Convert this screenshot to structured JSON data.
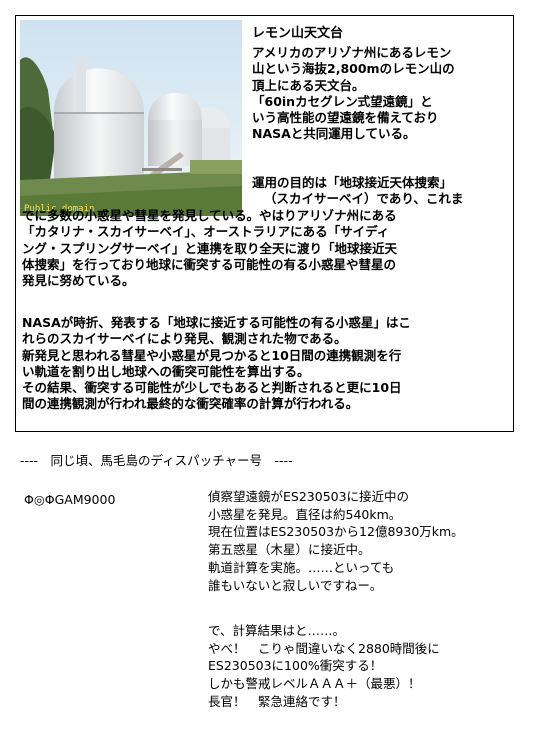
{
  "box": {
    "photo_credit": "Public domain",
    "title": "レモン山天文台",
    "para1_lines": [
      "アメリカのアリゾナ州にあるレモン",
      "山という海抜2,800mのレモン山の",
      "頂上にある天文台。",
      "「60inカセグレン式望遠鏡」と",
      "いう高性能の望遠鏡を備えており",
      "NASAと共同運用している。"
    ],
    "para2_side_lines": [
      "運用の目的は「地球接近天体捜索」",
      "（スカイサーベイ）であり、これま"
    ],
    "para2_full_lines": [
      "でに多数の小惑星や彗星を発見している。やはりアリゾナ州にある",
      "「カタリナ・スカイサーベイ」、オーストラリアにある「サイディ",
      "ング・スプリングサーベイ」と連携を取り全天に渡り「地球接近天",
      "体捜索」を行っており地球に衝突する可能性の有る小惑星や彗星の",
      "発見に努めている。"
    ],
    "para3_lines": [
      "NASAが時折、発表する「地球に接近する可能性の有る小惑星」はこ",
      "れらのスカイサーベイにより発見、観測された物である。",
      "新発見と思われる彗星や小惑星が見つかると10日間の連携観測を行",
      "い軌道を割り出し地球への衝突可能性を算出する。",
      "その結果、衝突する可能性が少しでもあると判断されると更に10日",
      "間の連携観測が行われ最終的な衝突確率の計算が行われる。"
    ]
  },
  "separator": "----　同じ頃、馬毛島のディスパッチャー号　----",
  "sender": "Φ◎ΦGAM9000",
  "message1_lines": [
    "偵察望遠鏡がES230503に接近中の",
    "小惑星を発見。直径は約540km。",
    "現在位置はES230503から12億8930万km。",
    "第五惑星（木星）に接近中。",
    "軌道計算を実施。……といっても",
    "誰もいないと寂しいですねー。"
  ],
  "message2_lines": [
    "で、計算結果はと……。",
    "やべ！　こりゃ間違いなく2880時間後に",
    "ES230503に100%衝突する！",
    "しかも警戒レベルＡＡＡ＋（最悪）！",
    "長官！　緊急連絡です！"
  ]
}
